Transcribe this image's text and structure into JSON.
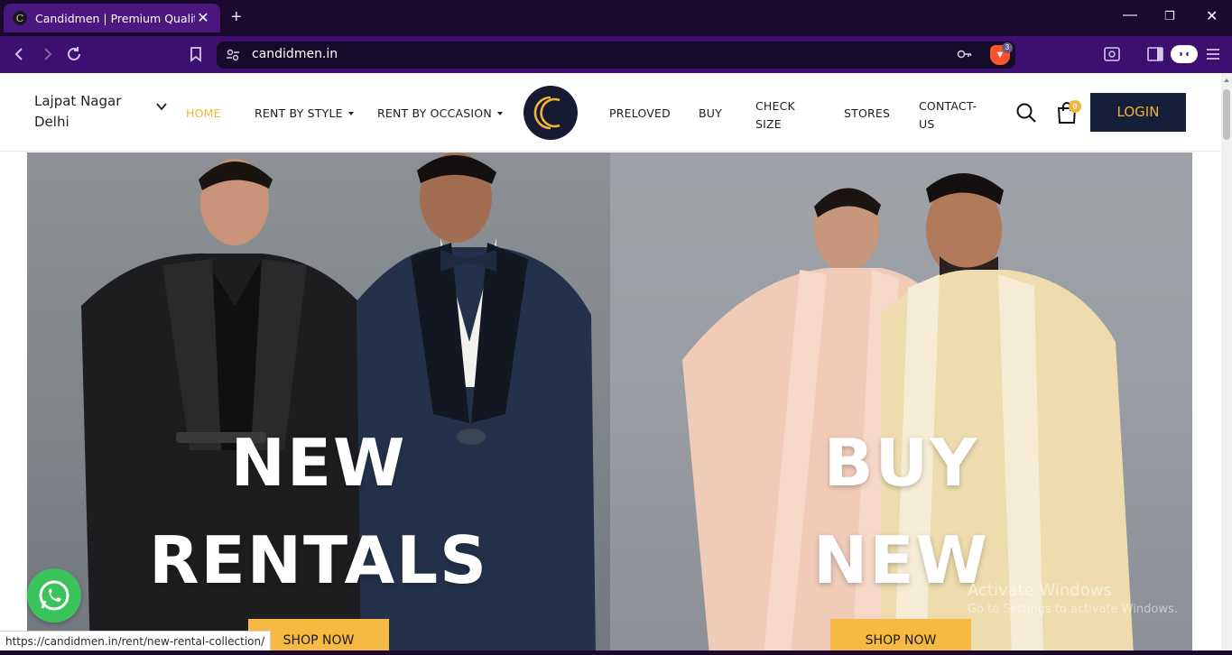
{
  "browser": {
    "tab_title": "Candidmen | Premium Quality Rental",
    "tab_favicon": "C",
    "new_tab": "+",
    "url": "candidmen.in",
    "brave_shield_count": "3",
    "status_url": "https://candidmen.in/rent/new-rental-collection/"
  },
  "header": {
    "location_line1": "Lajpat Nagar",
    "location_line2": "Delhi",
    "nav": {
      "home": "HOME",
      "rent_by_style": "RENT BY STYLE",
      "rent_by_occasion": "RENT BY OCCASION",
      "preloved": "PRELOVED",
      "buy": "BUY",
      "check_size_1": "CHECK",
      "check_size_2": "SIZE",
      "stores": "STORES",
      "contact_1": "CONTACT-",
      "contact_2": "US"
    },
    "cart_count": "0",
    "login_label": "LOGIN"
  },
  "hero": {
    "left": {
      "title_line1": "NEW",
      "title_line2": "RENTALS",
      "button": "SHOP NOW"
    },
    "right": {
      "title_line1": "BUY",
      "title_line2": "NEW",
      "button": "SHOP NOW"
    }
  },
  "watermark": {
    "line1": "Activate Windows",
    "line2": "Go to Settings to activate Windows."
  },
  "colors": {
    "accent": "#f2b33a",
    "navy": "#161f3a",
    "browser_purple": "#3d0f70"
  },
  "icons": [
    "back-icon",
    "forward-icon",
    "reload-icon",
    "bookmark-icon",
    "site-settings-icon",
    "key-icon",
    "brave-shield-icon",
    "search-icon",
    "cart-icon",
    "whatsapp-icon",
    "chevron-down-icon"
  ]
}
